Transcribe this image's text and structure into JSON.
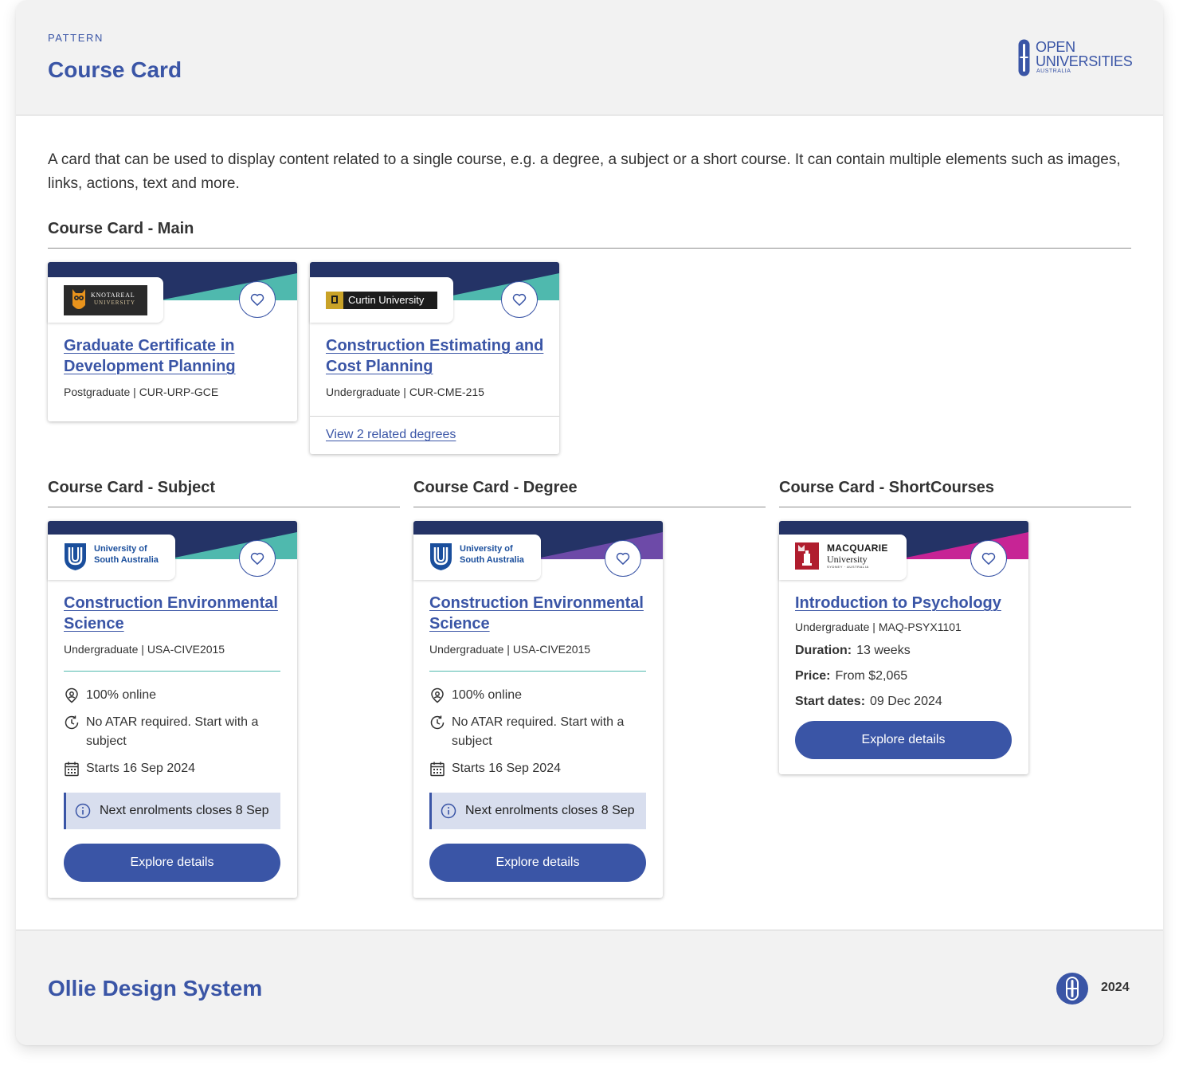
{
  "header": {
    "eyebrow": "PATTERN",
    "title": "Course Card",
    "brand": {
      "line1": "OPEN",
      "line2": "UNIVERSITIES",
      "line3": "AUSTRALIA"
    }
  },
  "intro": "A card that can be used to display content related to a single course, e.g. a degree, a subject or a short course. It can contain multiple elements such as images, links, actions, text and more.",
  "sections": {
    "main": "Course Card - Main",
    "subject": "Course Card - Subject",
    "degree": "Course Card - Degree",
    "short": "Course Card - ShortCourses"
  },
  "colors": {
    "brand": "#3a55a6",
    "banner_navy": "#243366",
    "accent_teal": "#4fb9ae",
    "accent_purple": "#6d4aa8",
    "accent_magenta": "#c72495",
    "notice_bg": "#d8deee"
  },
  "cards": {
    "main1": {
      "logo": {
        "line1": "KNOTAREAL",
        "line2": "UNIVERSITY"
      },
      "title": "Graduate Certificate in Development Planning",
      "meta": "Postgraduate | CUR-URP-GCE"
    },
    "main2": {
      "logo": {
        "name": "Curtin University"
      },
      "title": "Construction Estimating and Cost Planning",
      "meta": "Undergraduate | CUR-CME-215",
      "footer_link": "View 2 related degrees"
    },
    "subject": {
      "logo": {
        "line1": "University of",
        "line2": "South Australia"
      },
      "title": "Construction Environmental Science",
      "meta": "Undergraduate | USA-CIVE2015",
      "features": [
        "100% online",
        "No ATAR required. Start with a subject",
        "Starts 16 Sep 2024"
      ],
      "notice": "Next enrolments closes 8 Sep",
      "button": "Explore details"
    },
    "degree": {
      "logo": {
        "line1": "University of",
        "line2": "South Australia"
      },
      "title": "Construction Environmental Science",
      "meta": "Undergraduate | USA-CIVE2015",
      "features": [
        "100% online",
        "No ATAR required. Start with a subject",
        "Starts 16 Sep 2024"
      ],
      "notice": "Next enrolments closes 8 Sep",
      "button": "Explore details"
    },
    "short": {
      "logo": {
        "line1": "MACQUARIE",
        "line2": "University",
        "line3": "SYDNEY · AUSTRALIA"
      },
      "title": "Introduction to Psychology",
      "meta": "Undergraduate | MAQ-PSYX1101",
      "details": [
        {
          "label": "Duration:",
          "value": "13 weeks"
        },
        {
          "label": "Price:",
          "value": "From $2,065"
        },
        {
          "label": "Start dates:",
          "value": "09 Dec 2024"
        }
      ],
      "button": "Explore details"
    }
  },
  "footer": {
    "title": "Ollie Design System",
    "year": "2024"
  },
  "icons": [
    "heart-icon",
    "location-pin-icon",
    "clock-refresh-icon",
    "calendar-icon",
    "info-icon",
    "ou-logo-icon"
  ]
}
